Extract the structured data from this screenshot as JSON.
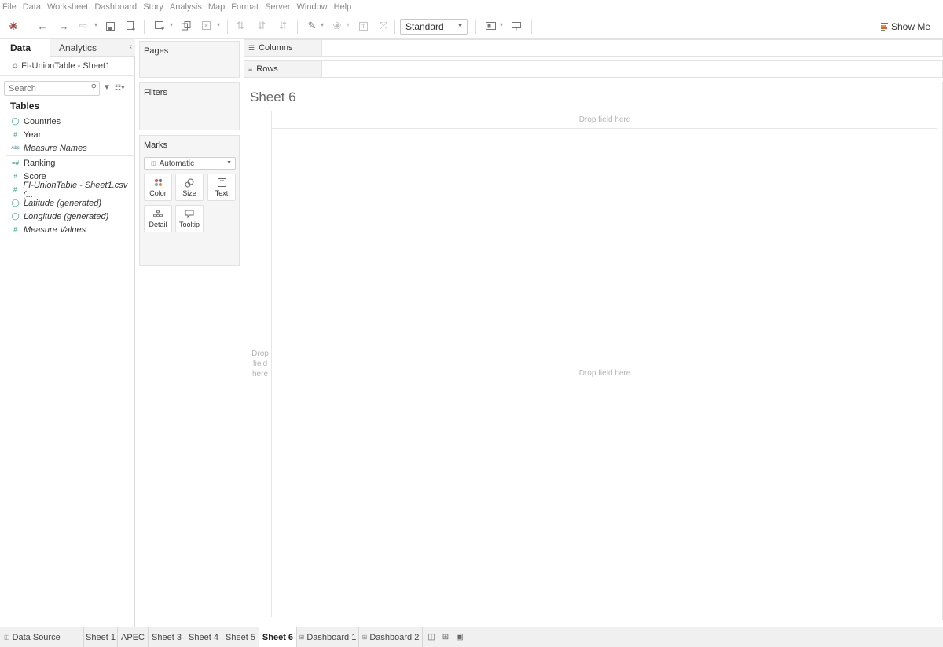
{
  "menu": [
    "File",
    "Data",
    "Worksheet",
    "Dashboard",
    "Story",
    "Analysis",
    "Map",
    "Format",
    "Server",
    "Window",
    "Help"
  ],
  "toolbar": {
    "fit_value": "Standard",
    "show_me_label": "Show Me",
    "show_me_colors": [
      "#4e79a7",
      "#f28e2b",
      "#e15759",
      "#59a14f"
    ]
  },
  "data_pane": {
    "tab_data": "Data",
    "tab_analytics": "Analytics",
    "datasource": "FI-UnionTable - Sheet1",
    "search_placeholder": "Search",
    "tables_heading": "Tables",
    "fields": [
      {
        "name": "Countries",
        "icon": "globe-icon",
        "italic": false
      },
      {
        "name": "Year",
        "icon": "number-icon",
        "italic": false
      },
      {
        "name": "Measure Names",
        "icon": "text-icon",
        "italic": true
      },
      {
        "name": "Ranking",
        "icon": "number-icon",
        "italic": false
      },
      {
        "name": "Score",
        "icon": "number-icon",
        "italic": false
      },
      {
        "name": "FI-UnionTable - Sheet1.csv (...",
        "icon": "number-icon",
        "italic": true
      },
      {
        "name": "Latitude (generated)",
        "icon": "globe-icon",
        "italic": true
      },
      {
        "name": "Longitude (generated)",
        "icon": "globe-icon",
        "italic": true
      },
      {
        "name": "Measure Values",
        "icon": "number-icon",
        "italic": true
      }
    ]
  },
  "cards": {
    "pages": "Pages",
    "filters": "Filters",
    "marks": "Marks",
    "mark_type": "Automatic",
    "mark_buttons": {
      "color": "Color",
      "size": "Size",
      "text": "Text",
      "detail": "Detail",
      "tooltip": "Tooltip"
    }
  },
  "shelves": {
    "columns": "Columns",
    "rows": "Rows"
  },
  "view": {
    "title": "Sheet 6",
    "col_drop": "Drop field here",
    "row_drop": "Drop field here",
    "body_drop": "Drop field here"
  },
  "tabs": {
    "data_source": "Data Source",
    "sheets": [
      "Sheet 1",
      "APEC",
      "Sheet 3",
      "Sheet 4",
      "Sheet 5",
      "Sheet 6",
      "Dashboard 1",
      "Dashboard 2"
    ],
    "active": "Sheet 6"
  }
}
